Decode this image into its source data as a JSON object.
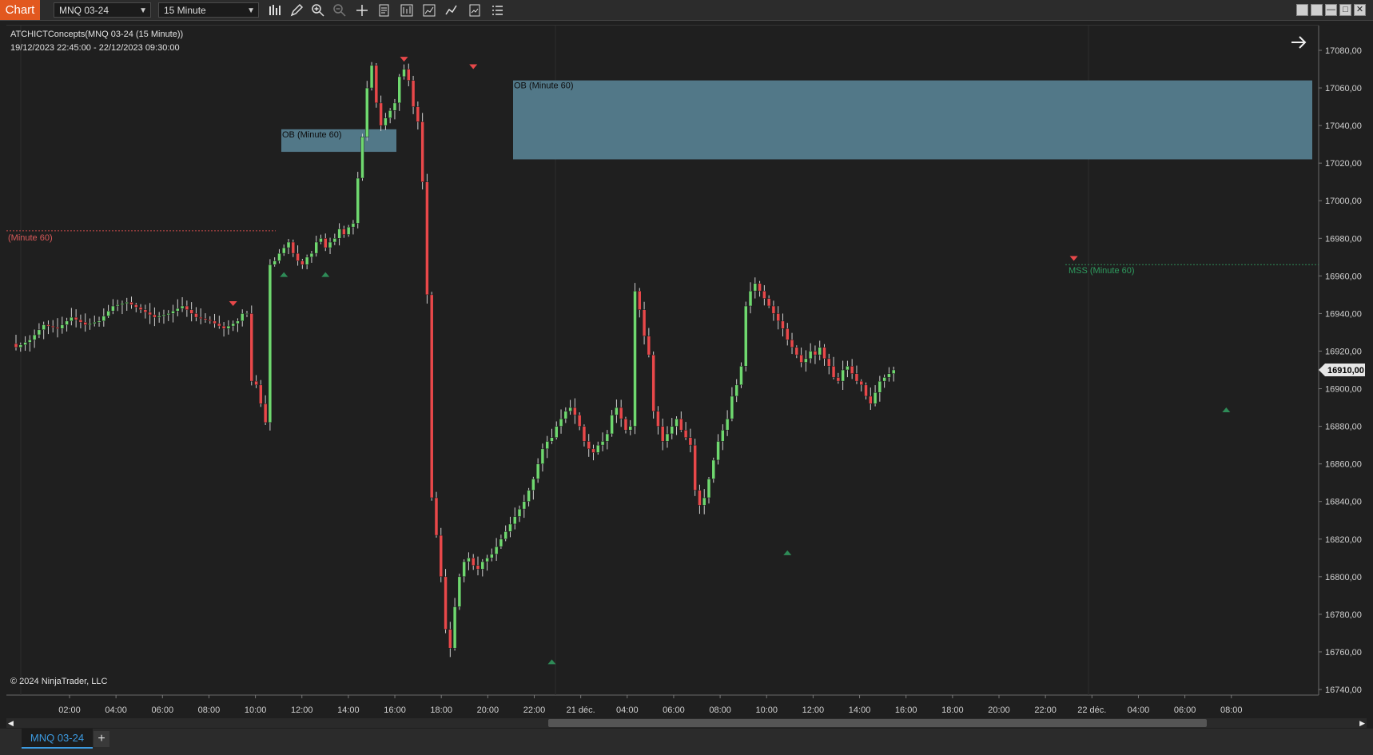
{
  "toolbar": {
    "chart_tab_label": "Chart",
    "instrument_select": "MNQ 03-24",
    "interval_select": "15 Minute",
    "tools": [
      "bar-type-icon",
      "draw-pencil-icon",
      "zoom-in-icon",
      "zoom-out-icon",
      "crosshair-icon",
      "data-box-icon",
      "chart-properties-icon",
      "strategies-icon",
      "indicators-icon",
      "chart-trader-icon",
      "menu-list-icon"
    ],
    "window_buttons": [
      "tile-icon",
      "tile-2-icon",
      "minimize-icon",
      "maximize-icon",
      "close-icon"
    ]
  },
  "chart": {
    "indicator_title": "ATCHICTConcepts(MNQ 03-24 (15 Minute))",
    "date_range": "19/12/2023 22:45:00 - 22/12/2023 09:30:00",
    "copyright": "© 2024 NinjaTrader, LLC",
    "annotations": {
      "ob1": "OB (Minute 60)",
      "ob2": "OB (Minute 60)",
      "level_left": "(Minute 60)",
      "mss": "MSS (Minute 60)"
    },
    "price_labels": [
      "17080,00",
      "17060,00",
      "17040,00",
      "17020,00",
      "17000,00",
      "16980,00",
      "16960,00",
      "16940,00",
      "16920,00",
      "16900,00",
      "16880,00",
      "16860,00",
      "16840,00",
      "16820,00",
      "16800,00",
      "16780,00",
      "16760,00",
      "16740,00"
    ],
    "current_price": "16910,00",
    "time_labels": [
      "02:00",
      "04:00",
      "06:00",
      "08:00",
      "10:00",
      "12:00",
      "14:00",
      "16:00",
      "18:00",
      "20:00",
      "22:00",
      "21 déc.",
      "04:00",
      "06:00",
      "08:00",
      "10:00",
      "12:00",
      "14:00",
      "16:00",
      "18:00",
      "20:00",
      "22:00",
      "22 déc.",
      "04:00",
      "06:00",
      "08:00"
    ],
    "colors": {
      "up": "#6fd86f",
      "down": "#e8484a",
      "ob_fill": "#527888",
      "mss_line": "#2e8b57",
      "level_line": "#c84a4a"
    }
  },
  "chart_data": {
    "type": "candlestick",
    "instrument": "MNQ 03-24",
    "interval": "15 Minute",
    "ylim": [
      16740,
      17090
    ],
    "close_path": [
      [
        0,
        16922
      ],
      [
        3,
        16926
      ],
      [
        6,
        16934
      ],
      [
        9,
        16932
      ],
      [
        12,
        16938
      ],
      [
        15,
        16934
      ],
      [
        18,
        16936
      ],
      [
        21,
        16944
      ],
      [
        24,
        16946
      ],
      [
        27,
        16942
      ],
      [
        30,
        16938
      ],
      [
        33,
        16940
      ],
      [
        36,
        16944
      ],
      [
        39,
        16938
      ],
      [
        42,
        16936
      ],
      [
        45,
        16932
      ],
      [
        48,
        16936
      ],
      [
        49,
        16940
      ],
      [
        50,
        16940
      ],
      [
        51,
        16904
      ],
      [
        52,
        16902
      ],
      [
        53,
        16892
      ],
      [
        54,
        16882
      ],
      [
        55,
        16966
      ],
      [
        56,
        16968
      ],
      [
        57,
        16972
      ],
      [
        58,
        16975
      ],
      [
        59,
        16978
      ],
      [
        60,
        16972
      ],
      [
        61,
        16968
      ],
      [
        62,
        16966
      ],
      [
        63,
        16970
      ],
      [
        64,
        16972
      ],
      [
        65,
        16978
      ],
      [
        66,
        16980
      ],
      [
        67,
        16975
      ],
      [
        68,
        16978
      ],
      [
        69,
        16980
      ],
      [
        70,
        16985
      ],
      [
        71,
        16982
      ],
      [
        72,
        16986
      ],
      [
        73,
        16988
      ],
      [
        74,
        17012
      ],
      [
        75,
        17034
      ],
      [
        76,
        17060
      ],
      [
        77,
        17072
      ],
      [
        78,
        17052
      ],
      [
        79,
        17040
      ],
      [
        80,
        17044
      ],
      [
        81,
        17048
      ],
      [
        82,
        17052
      ],
      [
        83,
        17066
      ],
      [
        84,
        17070
      ],
      [
        85,
        17064
      ],
      [
        86,
        17050
      ],
      [
        87,
        17042
      ],
      [
        88,
        17010
      ],
      [
        89,
        16950
      ],
      [
        90,
        16842
      ],
      [
        91,
        16822
      ],
      [
        92,
        16800
      ],
      [
        93,
        16772
      ],
      [
        94,
        16762
      ],
      [
        95,
        16784
      ],
      [
        96,
        16800
      ],
      [
        97,
        16808
      ],
      [
        98,
        16810
      ],
      [
        99,
        16806
      ],
      [
        100,
        16804
      ],
      [
        101,
        16808
      ],
      [
        102,
        16810
      ],
      [
        103,
        16812
      ],
      [
        104,
        16816
      ],
      [
        105,
        16820
      ],
      [
        106,
        16824
      ],
      [
        107,
        16828
      ],
      [
        108,
        16832
      ],
      [
        109,
        16836
      ],
      [
        110,
        16840
      ],
      [
        111,
        16846
      ],
      [
        112,
        16852
      ],
      [
        113,
        16860
      ],
      [
        114,
        16868
      ],
      [
        115,
        16872
      ],
      [
        116,
        16874
      ],
      [
        117,
        16880
      ],
      [
        118,
        16884
      ],
      [
        119,
        16888
      ],
      [
        120,
        16890
      ],
      [
        121,
        16886
      ],
      [
        122,
        16880
      ],
      [
        123,
        16872
      ],
      [
        124,
        16868
      ],
      [
        125,
        16866
      ],
      [
        126,
        16870
      ],
      [
        127,
        16872
      ],
      [
        128,
        16876
      ],
      [
        129,
        16886
      ],
      [
        130,
        16890
      ],
      [
        131,
        16884
      ],
      [
        132,
        16878
      ],
      [
        133,
        16880
      ],
      [
        134,
        16952
      ],
      [
        135,
        16942
      ],
      [
        136,
        16928
      ],
      [
        137,
        16918
      ],
      [
        138,
        16888
      ],
      [
        139,
        16880
      ],
      [
        140,
        16872
      ],
      [
        141,
        16876
      ],
      [
        142,
        16880
      ],
      [
        143,
        16884
      ],
      [
        144,
        16878
      ],
      [
        145,
        16874
      ],
      [
        146,
        16870
      ],
      [
        147,
        16846
      ],
      [
        148,
        16838
      ],
      [
        149,
        16842
      ],
      [
        150,
        16852
      ],
      [
        151,
        16862
      ],
      [
        152,
        16872
      ],
      [
        153,
        16878
      ],
      [
        154,
        16884
      ],
      [
        155,
        16896
      ],
      [
        156,
        16902
      ],
      [
        157,
        16912
      ],
      [
        158,
        16944
      ],
      [
        159,
        16952
      ],
      [
        160,
        16956
      ],
      [
        161,
        16952
      ],
      [
        162,
        16948
      ],
      [
        163,
        16944
      ],
      [
        164,
        16940
      ],
      [
        165,
        16936
      ],
      [
        166,
        16932
      ],
      [
        167,
        16926
      ],
      [
        168,
        16922
      ],
      [
        169,
        16918
      ],
      [
        170,
        16914
      ],
      [
        171,
        16916
      ],
      [
        172,
        16920
      ],
      [
        173,
        16918
      ],
      [
        174,
        16922
      ],
      [
        175,
        16916
      ],
      [
        176,
        16912
      ],
      [
        177,
        16906
      ],
      [
        178,
        16904
      ],
      [
        179,
        16910
      ],
      [
        180,
        16912
      ],
      [
        181,
        16908
      ],
      [
        182,
        16904
      ],
      [
        183,
        16902
      ],
      [
        184,
        16896
      ],
      [
        185,
        16892
      ],
      [
        186,
        16898
      ],
      [
        187,
        16904
      ],
      [
        188,
        16906
      ],
      [
        189,
        16908
      ],
      [
        190,
        16910
      ]
    ],
    "swing_markers": {
      "highs": [
        [
          47,
          16944
        ],
        [
          84,
          17074
        ],
        [
          99,
          17070
        ],
        [
          229,
          16968
        ]
      ],
      "lows": [
        [
          58,
          16962
        ],
        [
          67,
          16962
        ],
        [
          116,
          16756
        ],
        [
          167,
          16814
        ],
        [
          262,
          16890
        ]
      ]
    },
    "order_blocks": [
      {
        "label": "OB (Minute 60)",
        "top": 17038,
        "bottom": 17026
      },
      {
        "label": "OB (Minute 60)",
        "top": 17064,
        "bottom": 17022
      }
    ],
    "levels": [
      {
        "label": "(Minute 60)",
        "price": 16984
      },
      {
        "label": "MSS (Minute 60)",
        "price": 16966
      }
    ],
    "last_price": 16910
  }
}
